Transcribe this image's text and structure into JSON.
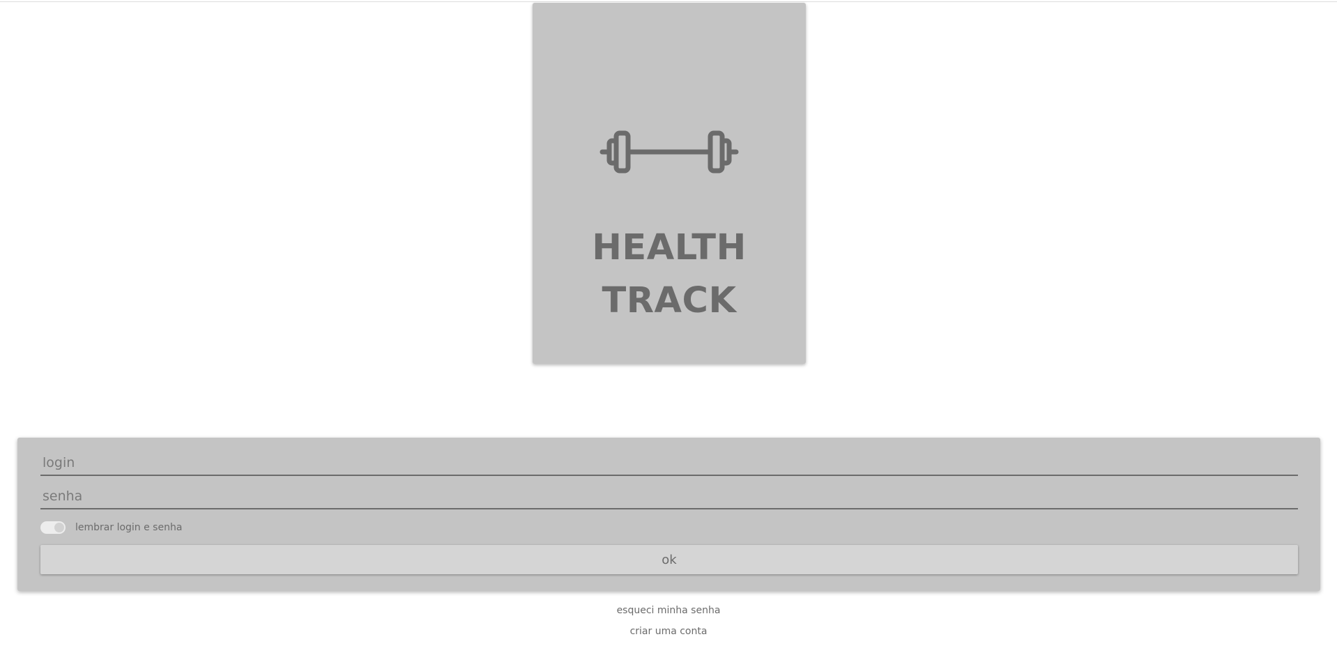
{
  "brand": {
    "line1": "HEALTH",
    "line2": "TRACK",
    "icon": "barbell-icon"
  },
  "form": {
    "login_placeholder": "login",
    "login_value": "",
    "password_placeholder": "senha",
    "password_value": "",
    "remember_label": "lembrar login e senha",
    "remember_checked": true,
    "submit_label": "ok"
  },
  "links": {
    "forgot_password": "esqueci minha senha",
    "create_account": "criar uma conta"
  },
  "colors": {
    "card_background": "#c4c4c4",
    "text": "#6b6b6b",
    "button_background": "#d5d5d5",
    "toggle_track": "#ededed"
  }
}
